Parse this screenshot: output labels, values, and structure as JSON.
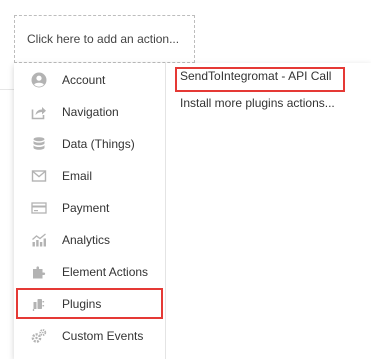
{
  "action_box": {
    "placeholder_text": "Click here to add an action..."
  },
  "menu": {
    "items": [
      {
        "label": "Account",
        "icon": "account-icon"
      },
      {
        "label": "Navigation",
        "icon": "navigation-icon"
      },
      {
        "label": "Data (Things)",
        "icon": "database-icon"
      },
      {
        "label": "Email",
        "icon": "email-icon"
      },
      {
        "label": "Payment",
        "icon": "payment-icon"
      },
      {
        "label": "Analytics",
        "icon": "analytics-icon"
      },
      {
        "label": "Element Actions",
        "icon": "element-actions-icon"
      },
      {
        "label": "Plugins",
        "icon": "plugins-icon"
      },
      {
        "label": "Custom Events",
        "icon": "custom-events-icon"
      }
    ],
    "selected": "Plugins"
  },
  "submenu": {
    "items": [
      {
        "label": "SendToIntegromat - API Call"
      },
      {
        "label": "Install more plugins actions..."
      }
    ]
  },
  "colors": {
    "highlight": "#e53935",
    "icon": "#b3b3b3"
  }
}
